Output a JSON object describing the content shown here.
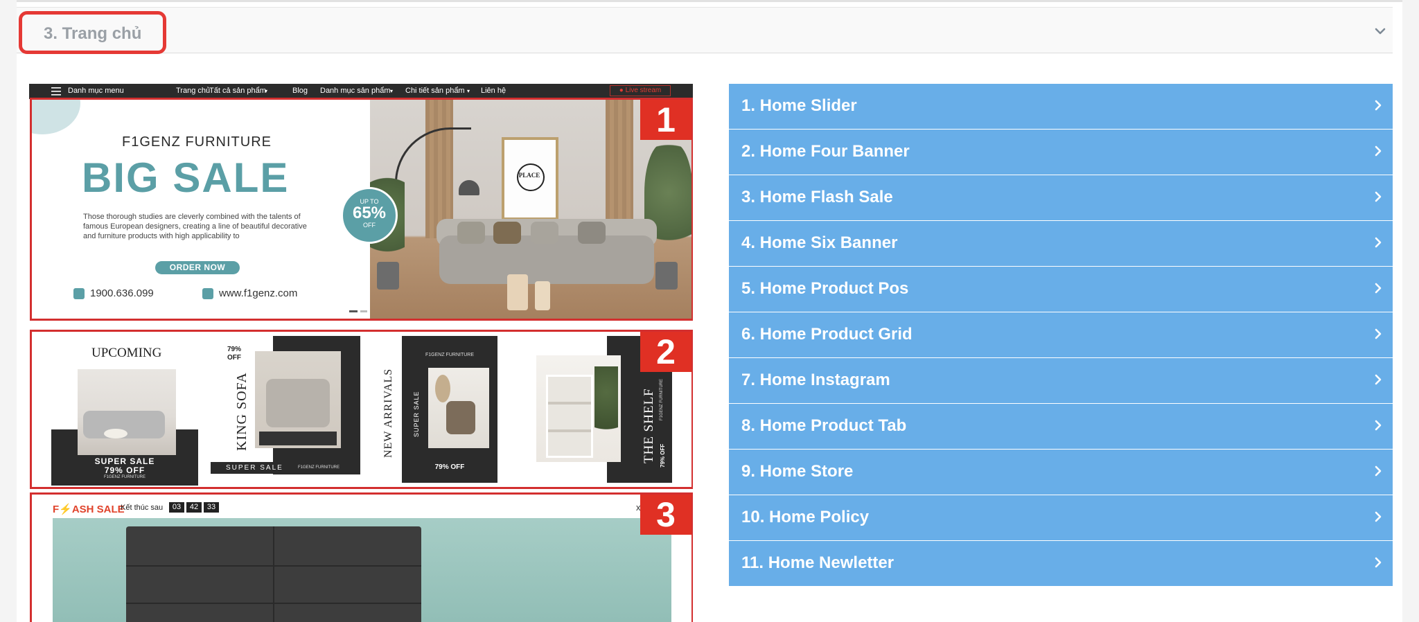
{
  "section": {
    "title": "3. Trang chủ",
    "chevron_icon": "chevron-down-icon"
  },
  "preview": {
    "navbar": {
      "menu_label": "Danh mục menu",
      "links": [
        "Trang chủ",
        "Tất cả sản phẩm",
        "Blog",
        "Danh mục sản phẩm",
        "Chi tiết sản phẩm",
        "Liên hệ"
      ],
      "live": "Live stream"
    },
    "slider": {
      "badge": "1",
      "brand": "F1GENZ FURNITURE",
      "headline": "BIG SALE",
      "description": "Those thorough studies are cleverly combined with the talents of famous European designers, creating a line of beautiful decorative and furniture products with high applicability to",
      "cta": "ORDER NOW",
      "phone": "1900.636.099",
      "website": "www.f1genz.com",
      "promo_top": "UP TO",
      "promo_value": "65%",
      "promo_bottom": "OFF",
      "frame_text": "PLACE"
    },
    "four_banner": {
      "badge": "2",
      "b1_title": "UPCOMING",
      "b1_sale": "SUPER SALE",
      "b1_off": "79% OFF",
      "b1_brand": "F1GENZ FURNITURE",
      "b2_off_top": "79%",
      "b2_off_bottom": "OFF",
      "b2_vertical": "KING SOFA",
      "b2_sale": "SUPER SALE",
      "b2_brand": "F1GENZ FURNITURE",
      "b3_vertical": "NEW ARRIVALS",
      "b3_brand": "F1GENZ FURNITURE",
      "b3_super": "SUPER SALE",
      "b3_off": "79% OFF",
      "b4_vertical": "THE SHELF",
      "b4_brand": "F1GENZ FURNITURE",
      "b4_off": "79% OFF"
    },
    "flash_sale": {
      "badge": "3",
      "title": "F⚡ASH SALE",
      "ends_label": "Kết thúc sau",
      "hours": "03",
      "minutes": "42",
      "seconds": "33",
      "close": "x"
    }
  },
  "sections_list": [
    {
      "label": "1. Home Slider"
    },
    {
      "label": "2. Home Four Banner"
    },
    {
      "label": "3. Home Flash Sale"
    },
    {
      "label": "4. Home Six Banner"
    },
    {
      "label": "5. Home Product Pos"
    },
    {
      "label": "6. Home Product Grid"
    },
    {
      "label": "7. Home Instagram"
    },
    {
      "label": "8. Home Product Tab"
    },
    {
      "label": "9. Home Store"
    },
    {
      "label": "10. Home Policy"
    },
    {
      "label": "11. Home Newletter"
    }
  ],
  "colors": {
    "accent_blue": "#68aee8",
    "highlight_red": "#e53935",
    "badge_red": "#e03024",
    "teal": "#5b9fa6"
  }
}
